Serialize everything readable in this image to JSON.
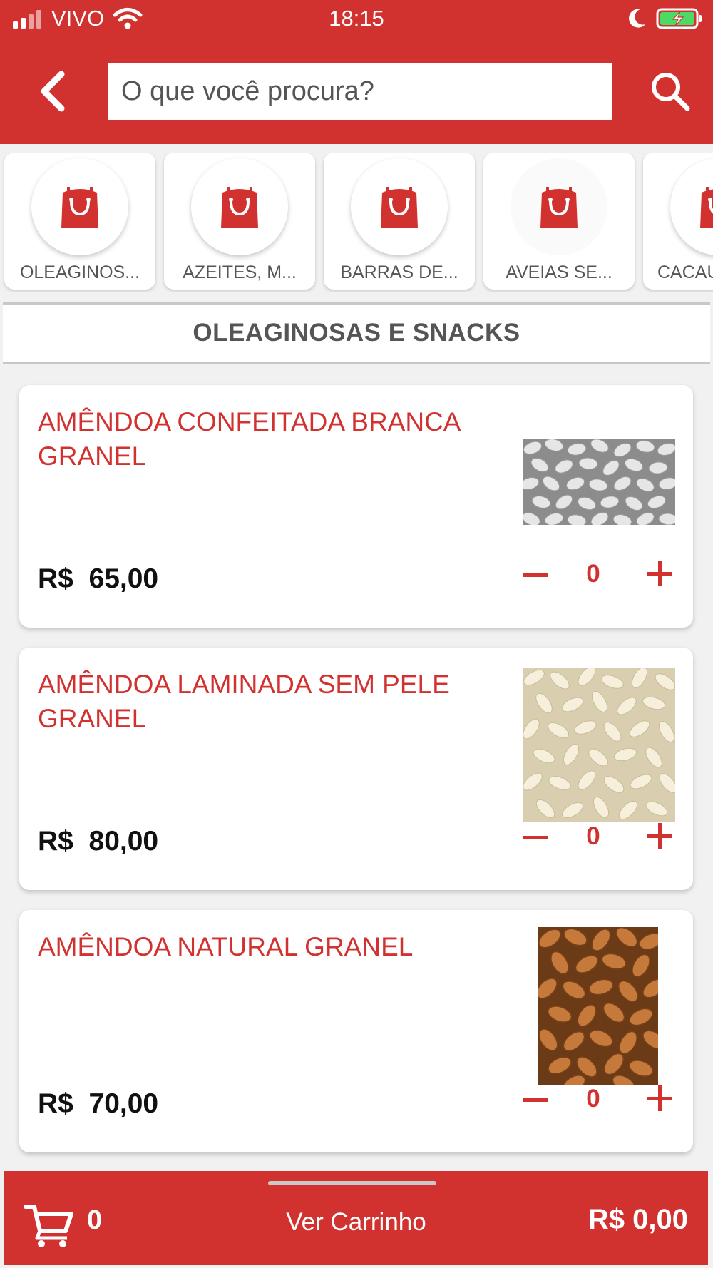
{
  "status_bar": {
    "carrier": "VIVO",
    "time": "18:15"
  },
  "header": {
    "search_placeholder": "O que você procura?",
    "colors": {
      "brand": "#d13230"
    }
  },
  "categories": [
    {
      "label": "OLEAGINOS..."
    },
    {
      "label": "AZEITES, M..."
    },
    {
      "label": "BARRAS DE..."
    },
    {
      "label": "AVEIAS SE..."
    },
    {
      "label": "CACAU"
    }
  ],
  "section": {
    "title": "OLEAGINOSAS E SNACKS"
  },
  "products": [
    {
      "name": "AMÊNDOA CONFEITADA BRANCA GRANEL",
      "currency": "R$",
      "price": "65,00",
      "quantity": "0",
      "image": "white-candied-almonds"
    },
    {
      "name": "AMÊNDOA LAMINADA SEM PELE GRANEL",
      "currency": "R$",
      "price": "80,00",
      "quantity": "0",
      "image": "sliced-almonds"
    },
    {
      "name": "AMÊNDOA NATURAL GRANEL",
      "currency": "R$",
      "price": "70,00",
      "quantity": "0",
      "image": "natural-almonds"
    }
  ],
  "cart": {
    "count": "0",
    "label": "Ver Carrinho",
    "total": "R$ 0,00"
  }
}
